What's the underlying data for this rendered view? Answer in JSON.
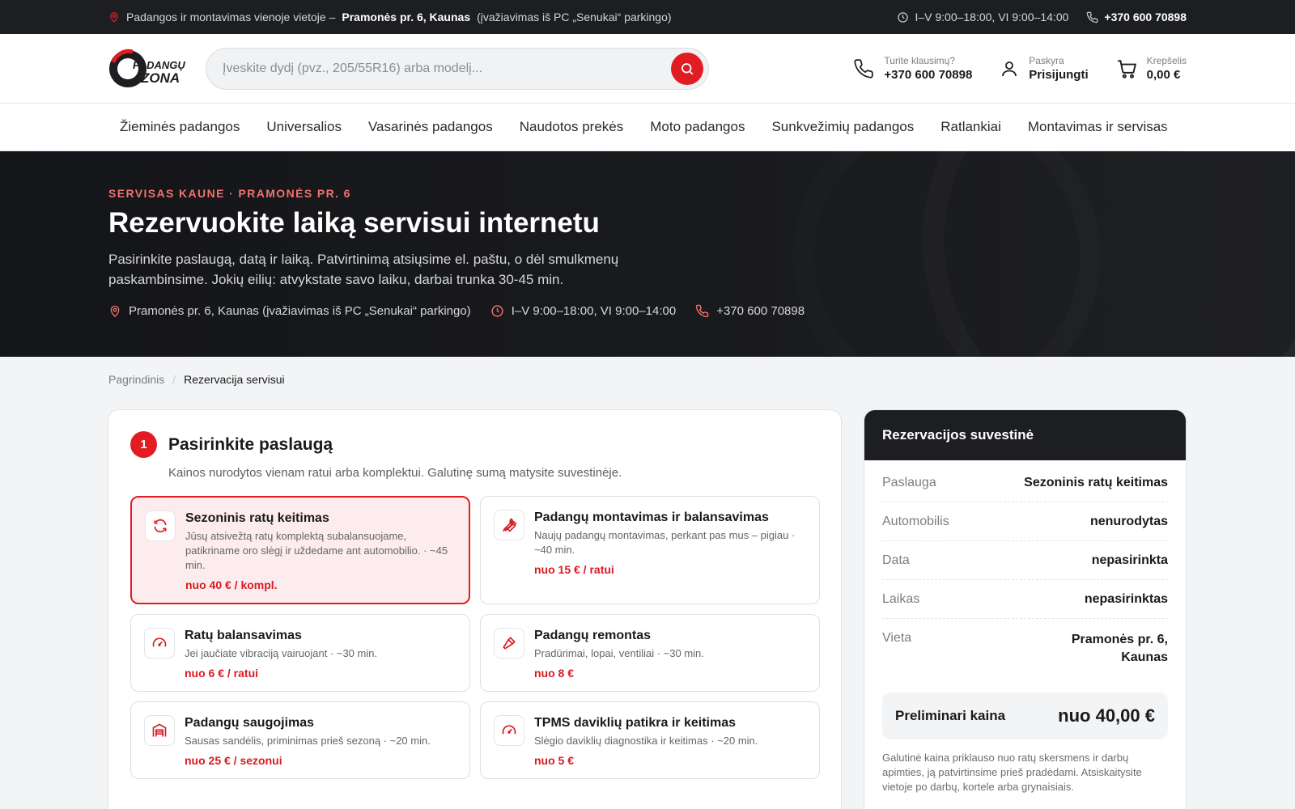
{
  "topbar": {
    "address_prefix": "Padangos ir montavimas vienoje vietoje –",
    "address_bold": "Pramonės pr. 6, Kaunas",
    "address_suffix": "(įvažiavimas iš PC „Senukai“ parkingo)",
    "hours": "I–V 9:00–18:00, VI 9:00–14:00",
    "phone": "+370 600 70898"
  },
  "header": {
    "logo_line1": "PADANGŲ",
    "logo_line2": "ZONA",
    "search_placeholder": "Įveskite dydį (pvz., 205/55R16) arba modelį...",
    "questions_label": "Turite klausimų?",
    "questions_phone": "+370 600 70898",
    "account_label": "Paskyra",
    "account_value": "Prisijungti",
    "cart_label": "Krepšelis",
    "cart_value": "0,00 €"
  },
  "nav": [
    "Žieminės padangos",
    "Universalios",
    "Vasarinės padangos",
    "Naudotos prekės",
    "Moto padangos",
    "Sunkvežimių padangos",
    "Ratlankiai",
    "Montavimas ir servisas"
  ],
  "hero": {
    "kicker": "SERVISAS KAUNE · PRAMONĖS PR. 6",
    "title": "Rezervuokite laiką servisui internetu",
    "description": "Pasirinkite paslaugą, datą ir laiką. Patvirtinimą atsiųsime el. paštu, o dėl smulkmenų paskambinsime. Jokių eilių: atvykstate savo laiku, darbai trunka 30-45 min.",
    "address": "Pramonės pr. 6, Kaunas (įvažiavimas iš PC „Senukai“ parkingo)",
    "hours": "I–V 9:00–18:00, VI 9:00–14:00",
    "phone": "+370 600 70898"
  },
  "breadcrumb": {
    "home": "Pagrindinis",
    "current": "Rezervacija servisui"
  },
  "step": {
    "number": "1",
    "title": "Pasirinkite paslaugą",
    "subtitle": "Kainos nurodytos vienam ratui arba komplektui. Galutinę sumą matysite suvestinėje."
  },
  "services": [
    {
      "icon": "refresh-icon",
      "title": "Sezoninis ratų keitimas",
      "desc": "Jūsų atsivežtą ratų komplektą subalansuojame, patikriname oro slėgį ir uždedame ant automobilio. · ~45 min.",
      "price": "nuo 40 € / kompl.",
      "selected": true
    },
    {
      "icon": "wrench-icon",
      "title": "Padangų montavimas ir balansavimas",
      "desc": "Naujų padangų montavimas, perkant pas mus – pigiau · ~40 min.",
      "price": "nuo 15 € / ratui",
      "selected": false
    },
    {
      "icon": "gauge-icon",
      "title": "Ratų balansavimas",
      "desc": "Jei jaučiate vibraciją vairuojant · ~30 min.",
      "price": "nuo 6 € / ratui",
      "selected": false
    },
    {
      "icon": "hammer-icon",
      "title": "Padangų remontas",
      "desc": "Pradūrimai, lopai, ventiliai · ~30 min.",
      "price": "nuo 8 €",
      "selected": false
    },
    {
      "icon": "warehouse-icon",
      "title": "Padangų saugojimas",
      "desc": "Sausas sandėlis, priminimas prieš sezoną · ~20 min.",
      "price": "nuo 25 € / sezonui",
      "selected": false
    },
    {
      "icon": "gauge-icon",
      "title": "TPMS daviklių patikra ir keitimas",
      "desc": "Slėgio daviklių diagnostika ir keitimas · ~20 min.",
      "price": "nuo 5 €",
      "selected": false
    }
  ],
  "summary": {
    "title": "Rezervacijos suvestinė",
    "rows": [
      {
        "key": "Paslauga",
        "value": "Sezoninis ratų keitimas"
      },
      {
        "key": "Automobilis",
        "value": "nenurodytas"
      },
      {
        "key": "Data",
        "value": "nepasirinkta"
      },
      {
        "key": "Laikas",
        "value": "nepasirinktas"
      },
      {
        "key": "Vieta",
        "value": "Pramonės pr. 6, Kaunas"
      }
    ],
    "price_label": "Preliminari kaina",
    "price_value": "nuo 40,00 €",
    "note": "Galutinė kaina priklauso nuo ratų skersmens ir darbų apimties, ją patvirtinsime prieš pradėdami. Atsiskaitysite vietoje po darbų, kortele arba grynaisiais."
  },
  "colors": {
    "accent": "#e11d23",
    "dark": "#1d1e21",
    "selected_bg": "#fdeced",
    "kicker": "#f0726f"
  }
}
